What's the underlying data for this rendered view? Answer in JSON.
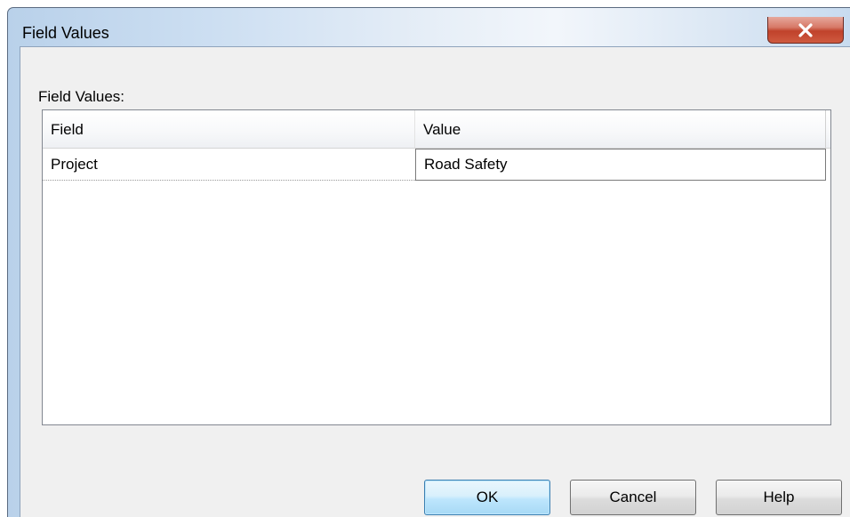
{
  "window": {
    "title": "Field Values"
  },
  "dialog": {
    "section_label": "Field Values:",
    "grid": {
      "columns": [
        "Field",
        "Value"
      ],
      "rows": [
        {
          "field": "Project",
          "value": "Road Safety"
        }
      ]
    },
    "buttons": {
      "ok": "OK",
      "cancel": "Cancel",
      "help": "Help"
    }
  },
  "icons": {
    "close": "close-icon"
  },
  "colors": {
    "close_button": "#c0422b",
    "default_button_border": "#3c7fb1",
    "dialog_background": "#f0f0f0"
  }
}
